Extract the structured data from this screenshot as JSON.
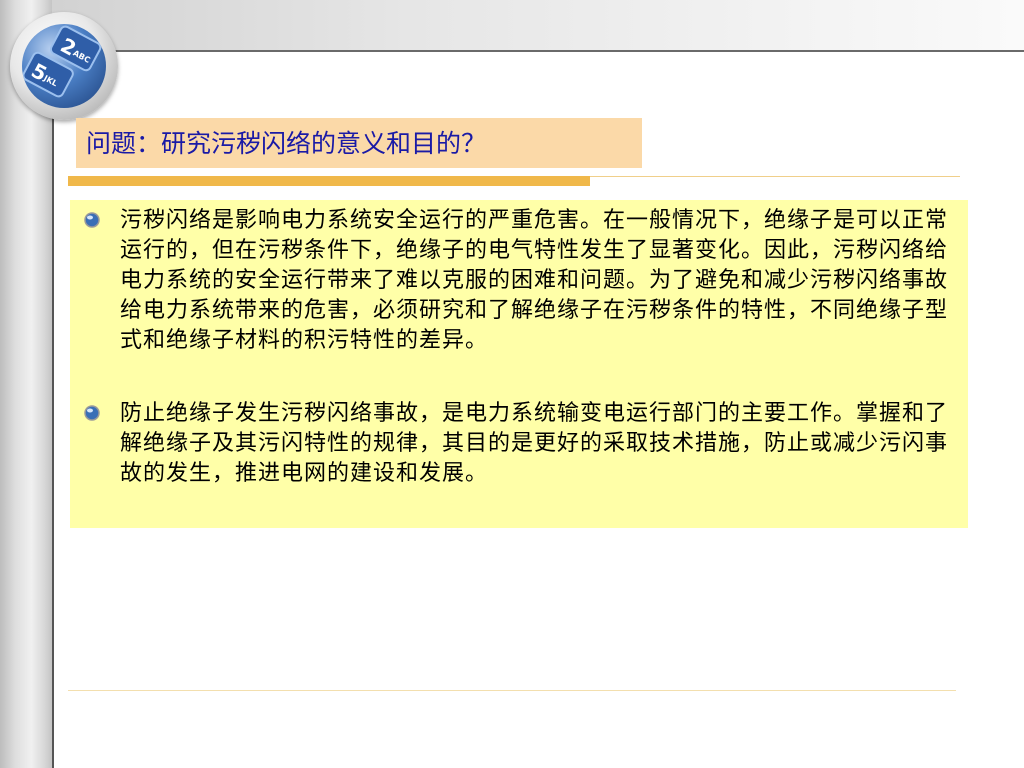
{
  "slide": {
    "title": "问题：研究污秽闪络的意义和目的？",
    "bullets": [
      "污秽闪络是影响电力系统安全运行的严重危害。在一般情况下，绝缘子是可以正常运行的，但在污秽条件下，绝缘子的电气特性发生了显著变化。因此，污秽闪络给电力系统的安全运行带来了难以克服的困难和问题。为了避免和减少污秽闪络事故给电力系统带来的危害，必须研究和了解绝缘子在污秽条件的特性，不同绝缘子型式和绝缘子材料的积污特性的差异。",
      "防止绝缘子发生污秽闪络事故，是电力系统输变电运行部门的主要工作。掌握和了解绝缘子及其污闪特性的规律，其目的是更好的采取技术措施，防止或减少污闪事故的发生，推进电网的建设和发展。"
    ]
  },
  "logo": {
    "key_top": "2",
    "key_top_sub": "ABC",
    "key_bottom": "5",
    "key_bottom_sub": "JKL"
  },
  "colors": {
    "title_text": "#1a1aa6",
    "title_bg": "#fbd9a8",
    "accent_bar": "#f0b84a",
    "content_bg": "#ffffa8"
  }
}
